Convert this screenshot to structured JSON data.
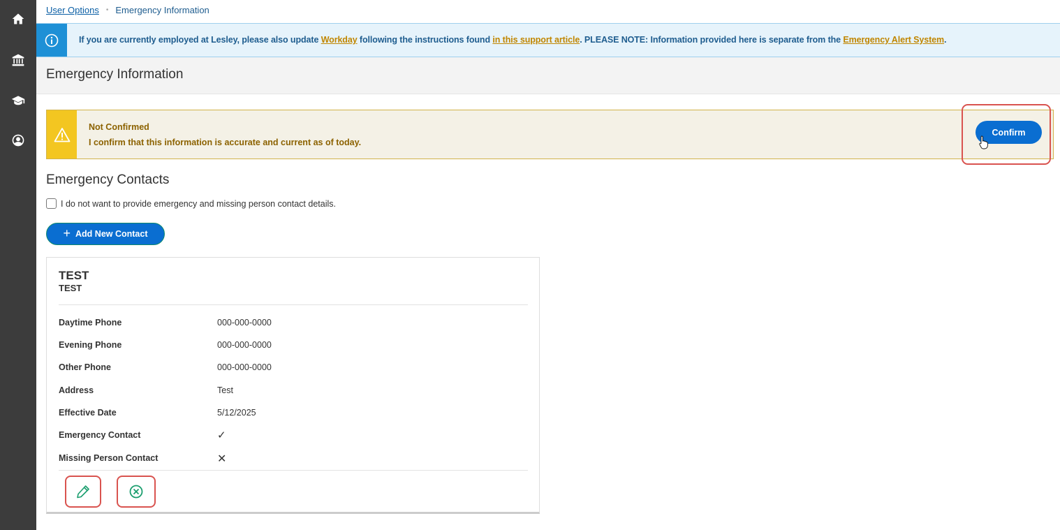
{
  "rail": {
    "items": [
      {
        "icon": "home-icon"
      },
      {
        "icon": "institution-icon"
      },
      {
        "icon": "graduation-cap-icon"
      },
      {
        "icon": "user-circle-icon"
      }
    ]
  },
  "breadcrumb": {
    "parent": "User Options",
    "separator": "•",
    "current": "Emergency Information"
  },
  "info_banner": {
    "icon": "info-icon",
    "text_1": "If you are currently employed at Lesley, please also update ",
    "link_workday": "Workday",
    "text_2": " following the instructions found ",
    "link_article": "in this support article",
    "text_3": ". PLEASE NOTE: Information provided here is separate from the ",
    "link_alert": "Emergency Alert System",
    "text_4": "."
  },
  "page_title": "Emergency Information",
  "confirmation": {
    "status_title": "Not Confirmed",
    "message": "I confirm that this information is accurate and current as of today.",
    "button_label": "Confirm",
    "icon": "warning-icon"
  },
  "contacts": {
    "section_title": "Emergency Contacts",
    "optout_label": "I do not want to provide emergency and missing person contact details.",
    "optout_checked": false,
    "add_button_label": "Add New Contact",
    "card": {
      "name": "TEST",
      "relationship": "TEST",
      "fields": [
        {
          "label": "Daytime Phone",
          "value": "000-000-0000"
        },
        {
          "label": "Evening Phone",
          "value": "000-000-0000"
        },
        {
          "label": "Other Phone",
          "value": "000-000-0000"
        },
        {
          "label": "Address",
          "value": "Test"
        },
        {
          "label": "Effective Date",
          "value": "5/12/2025"
        }
      ],
      "emergency_contact_label": "Emergency Contact",
      "emergency_contact_mark": "✓",
      "missing_person_label": "Missing Person Contact",
      "missing_person_mark": "✕"
    }
  },
  "colors": {
    "rail": "#3c3c3c",
    "primary": "#0a6ed1",
    "info": "#1e90d6",
    "warning": "#f3c621",
    "highlight": "#d9534f",
    "success": "#1a9e6e"
  }
}
